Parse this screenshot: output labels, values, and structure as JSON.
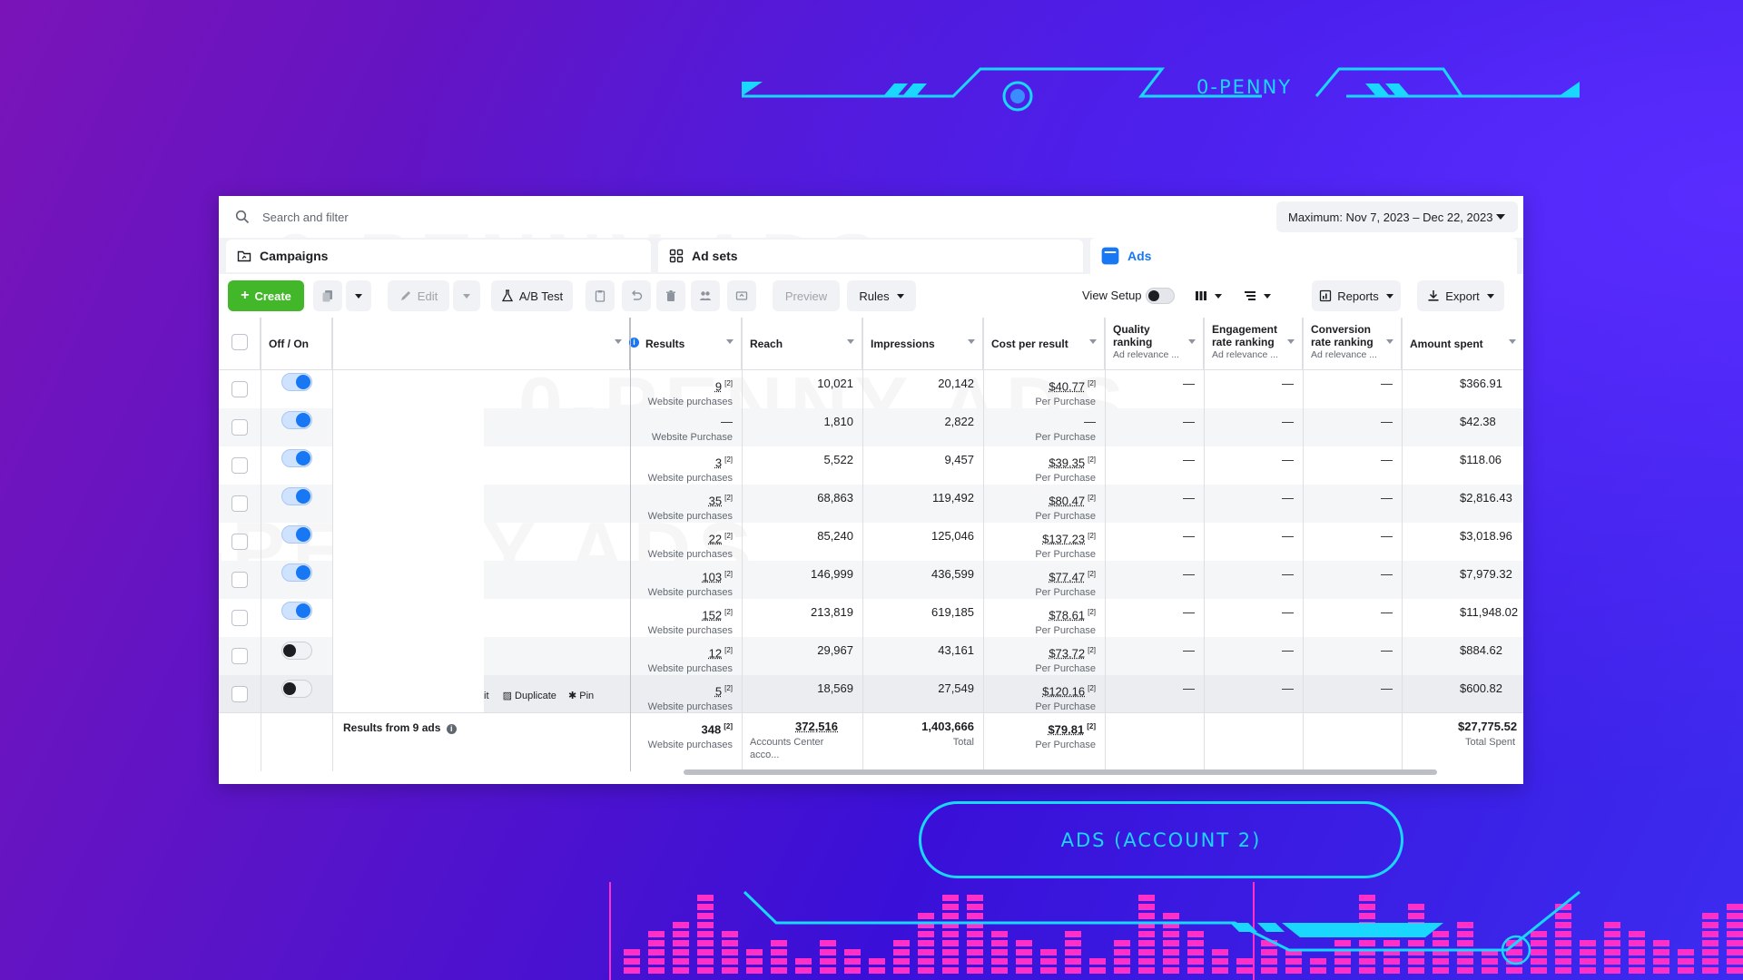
{
  "brand": "0-PENNY",
  "watermark": [
    "0-PENNY ADS",
    "0-PENNY ADS",
    "0-PENNY ADS"
  ],
  "search": {
    "placeholder": "Search and filter"
  },
  "date_range": "Maximum: Nov 7, 2023 – Dec 22, 2023",
  "tabs": {
    "campaigns": "Campaigns",
    "adsets": "Ad sets",
    "ads": "Ads"
  },
  "toolbar": {
    "create": "Create",
    "edit": "Edit",
    "ab_test": "A/B Test",
    "preview": "Preview",
    "rules": "Rules",
    "view_setup": "View Setup",
    "reports": "Reports",
    "export": "Export"
  },
  "columns": {
    "off_on": "Off / On",
    "results": "Results",
    "reach": "Reach",
    "impressions": "Impressions",
    "cost": "Cost per result",
    "quality": "Quality ranking",
    "quality_sub": "Ad relevance ...",
    "engagement": "Engagement rate ranking",
    "engagement_sub": "Ad relevance ...",
    "conversion": "Conversion rate ranking",
    "conversion_sub": "Ad relevance ...",
    "amount": "Amount spent"
  },
  "rows": [
    {
      "on": true,
      "results": "9",
      "results_sub": "Website purchases",
      "reach": "10,021",
      "impressions": "20,142",
      "cost": "$40.77",
      "cost_sub": "Per Purchase",
      "quality": "—",
      "engagement": "—",
      "conversion": "—",
      "amount": "$366.91"
    },
    {
      "on": true,
      "results": "—",
      "results_sub": "Website Purchase",
      "reach": "1,810",
      "impressions": "2,822",
      "cost": "—",
      "cost_sub": "Per Purchase",
      "quality": "—",
      "engagement": "—",
      "conversion": "—",
      "amount": "$42.38"
    },
    {
      "on": true,
      "results": "3",
      "results_sub": "Website purchases",
      "reach": "5,522",
      "impressions": "9,457",
      "cost": "$39.35",
      "cost_sub": "Per Purchase",
      "quality": "—",
      "engagement": "—",
      "conversion": "—",
      "amount": "$118.06"
    },
    {
      "on": true,
      "results": "35",
      "results_sub": "Website purchases",
      "reach": "68,863",
      "impressions": "119,492",
      "cost": "$80.47",
      "cost_sub": "Per Purchase",
      "quality": "—",
      "engagement": "—",
      "conversion": "—",
      "amount": "$2,816.43"
    },
    {
      "on": true,
      "results": "22",
      "results_sub": "Website purchases",
      "reach": "85,240",
      "impressions": "125,046",
      "cost": "$137.23",
      "cost_sub": "Per Purchase",
      "quality": "—",
      "engagement": "—",
      "conversion": "—",
      "amount": "$3,018.96"
    },
    {
      "on": true,
      "results": "103",
      "results_sub": "Website purchases",
      "reach": "146,999",
      "impressions": "436,599",
      "cost": "$77.47",
      "cost_sub": "Per Purchase",
      "quality": "—",
      "engagement": "—",
      "conversion": "—",
      "amount": "$7,979.32"
    },
    {
      "on": true,
      "results": "152",
      "results_sub": "Website purchases",
      "reach": "213,819",
      "impressions": "619,185",
      "cost": "$78.61",
      "cost_sub": "Per Purchase",
      "quality": "—",
      "engagement": "—",
      "conversion": "—",
      "amount": "$11,948.02"
    },
    {
      "on": false,
      "results": "12",
      "results_sub": "Website purchases",
      "reach": "29,967",
      "impressions": "43,161",
      "cost": "$73.72",
      "cost_sub": "Per Purchase",
      "quality": "—",
      "engagement": "—",
      "conversion": "—",
      "amount": "$884.62"
    },
    {
      "on": false,
      "results": "5",
      "results_sub": "Website purchases",
      "reach": "18,569",
      "impressions": "27,549",
      "cost": "$120.16",
      "cost_sub": "Per Purchase",
      "quality": "—",
      "engagement": "—",
      "conversion": "—",
      "amount": "$600.82"
    }
  ],
  "row_actions": {
    "edit": "it",
    "duplicate": "Duplicate",
    "pin": "Pin"
  },
  "footnote_marker": "[2]",
  "totals": {
    "label": "Results from 9 ads",
    "results": "348",
    "results_sub": "Website purchases",
    "reach": "372,516",
    "reach_sub": "Accounts Center acco...",
    "impressions": "1,403,666",
    "impressions_sub": "Total",
    "cost": "$79.81",
    "cost_sub": "Per Purchase",
    "amount": "$27,775.52",
    "amount_sub": "Total Spent"
  },
  "pill": "ADS (ACCOUNT 2)",
  "colors": {
    "accent": "#1ad7ff",
    "bar": "#ff2fc8",
    "primary": "#1877f2",
    "create": "#42b72a"
  }
}
